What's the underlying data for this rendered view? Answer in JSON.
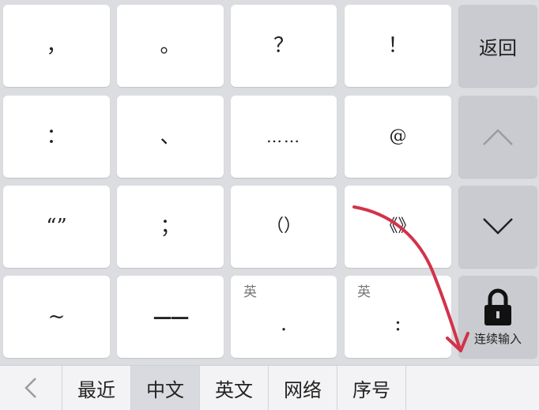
{
  "colors": {
    "keyboard_bg": "#dcdde1",
    "key_bg": "#ffffff",
    "function_key_bg": "#c9cbd0",
    "annotation_red": "#d2334a"
  },
  "rows": [
    [
      {
        "main": "，"
      },
      {
        "main": "。"
      },
      {
        "main": "？"
      },
      {
        "main": "！"
      }
    ],
    [
      {
        "main": "："
      },
      {
        "main": "、"
      },
      {
        "main": "……"
      },
      {
        "main": "@"
      }
    ],
    [
      {
        "main": "“”"
      },
      {
        "main": "；"
      },
      {
        "main": "（）"
      },
      {
        "main": "《》"
      }
    ],
    [
      {
        "main": "~"
      },
      {
        "main": "——"
      },
      {
        "sub": "英",
        "main": "."
      },
      {
        "sub": "英",
        "main": ":"
      }
    ]
  ],
  "side": {
    "back_label": "返回",
    "up_icon": "chevron-up-icon",
    "down_icon": "chevron-down-icon",
    "lock_icon": "padlock-icon",
    "lock_caption": "连续输入"
  },
  "bar": {
    "back_icon": "chevron-left-icon",
    "tabs": [
      {
        "label": "最近",
        "active": false
      },
      {
        "label": "中文",
        "active": true
      },
      {
        "label": "英文",
        "active": false
      },
      {
        "label": "网络",
        "active": false
      },
      {
        "label": "序号",
        "active": false
      }
    ]
  }
}
